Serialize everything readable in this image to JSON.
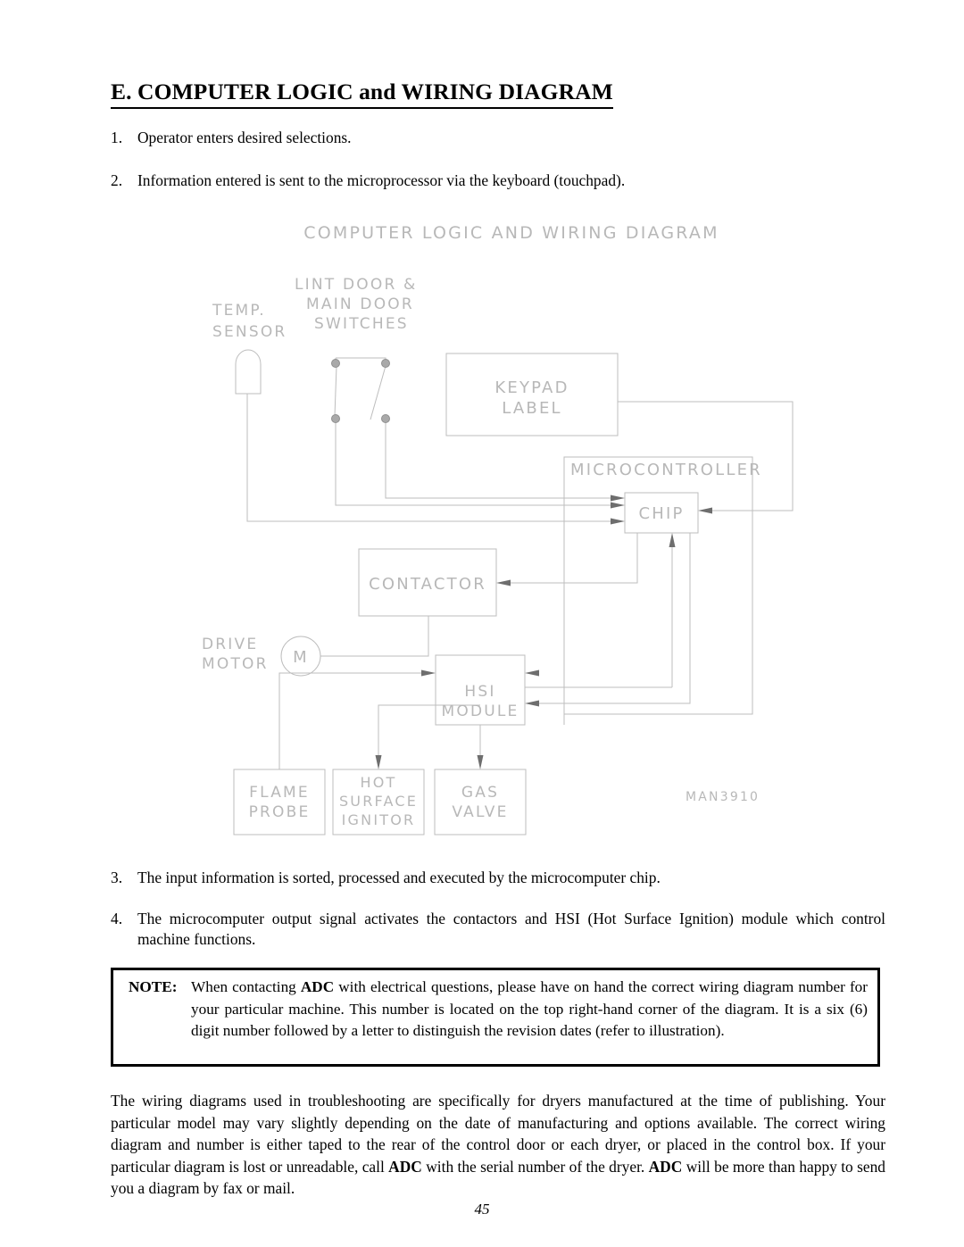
{
  "heading": {
    "label": "E.  COMPUTER LOGIC and WIRING DIAGRAM"
  },
  "steps": [
    {
      "num": "1.",
      "text": "Operator enters desired selections."
    },
    {
      "num": "2.",
      "text": "Information entered is sent to the microprocessor via the keyboard (touchpad)."
    },
    {
      "num": "3.",
      "text": "The input information is sorted, processed and executed by the microcomputer chip."
    },
    {
      "num": "4.",
      "text": "The microcomputer output signal activates the contactors and HSI (Hot Surface Ignition) module which control machine functions."
    }
  ],
  "note": {
    "label": "NOTE:",
    "text_before_adc": "When contacting ",
    "adc": "ADC",
    "text_after_adc": " with electrical questions, please have on hand the correct wiring diagram number for your particular machine.  This number is located on the top right-hand corner of the diagram.  It is a six (6) digit number followed by a letter to distinguish the revision dates (refer to illustration)."
  },
  "paragraph": {
    "part1": "The wiring diagrams used in troubleshooting are specifically for dryers manufactured at the time of publishing.  Your particular model may vary slightly depending on the date of manufacturing and options available.  The correct wiring diagram and number is either taped to the rear of the control door or each dryer, or placed in the control box.  If your particular diagram is lost or unreadable, call ",
    "adc1": "ADC",
    "part2": " with the serial number of the dryer.  ",
    "adc2": "ADC",
    "part3": " will be more than happy to send you a diagram by fax or mail."
  },
  "page_number": "45",
  "diagram": {
    "title": "COMPUTER LOGIC AND WIRING DIAGRAM",
    "drawing_number": "MAN3910",
    "line_color": "#bdbdbd",
    "text_color": "#b8b8b8",
    "arrow_color": "#6e6e6e",
    "labels": {
      "temp_sensor_line1": "TEMP.",
      "temp_sensor_line2": "SENSOR",
      "switches_line1": "LINT DOOR &",
      "switches_line2": "MAIN DOOR",
      "switches_line3": "SWITCHES",
      "keypad_line1": "KEYPAD",
      "keypad_line2": "LABEL",
      "microcontroller": "MICROCONTROLLER",
      "chip": "CHIP",
      "contactor": "CONTACTOR",
      "drive_motor_line1": "DRIVE",
      "drive_motor_line2": "MOTOR",
      "motor_symbol": "M",
      "hsi_line1": "HSI",
      "hsi_line2": "MODULE",
      "flame_probe_line1": "FLAME",
      "flame_probe_line2": "PROBE",
      "hsi_ignitor_line1": "HOT",
      "hsi_ignitor_line2": "SURFACE",
      "hsi_ignitor_line3": "IGNITOR",
      "gas_valve_line1": "GAS",
      "gas_valve_line2": "VALVE"
    }
  }
}
